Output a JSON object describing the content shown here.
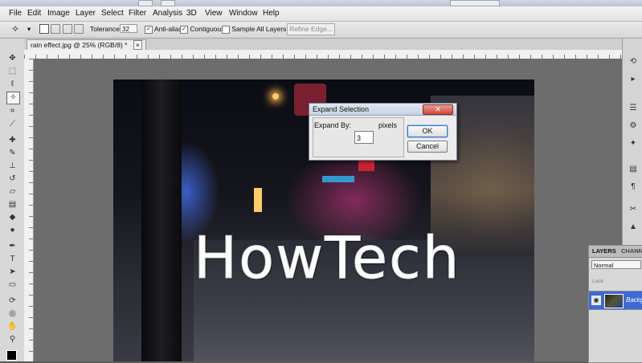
{
  "menu": [
    "File",
    "Edit",
    "Image",
    "Layer",
    "Select",
    "Filter",
    "Analysis",
    "3D",
    "View",
    "Window",
    "Help"
  ],
  "options_bar": {
    "tolerance_label": "Tolerance:",
    "tolerance_value": "32",
    "antialias_label": "Anti-alias",
    "contiguous_label": "Contiguous",
    "sample_all_label": "Sample All Layers",
    "refine_edge_label": "Refine Edge..."
  },
  "document_tab": {
    "title": "rain effect.jpg @ 25% (RGB/8) *",
    "close": "×"
  },
  "photo": {
    "watermark": "HowTech"
  },
  "dialog": {
    "title": "Expand Selection",
    "expand_by_label": "Expand By:",
    "expand_by_value": "3",
    "units_label": "pixels",
    "ok_label": "OK",
    "cancel_label": "Cancel",
    "close_symbol": "✕"
  },
  "layers_panel": {
    "tab_layers": "LAYERS",
    "tab_channels": "CHANNELS",
    "blend_mode": "Normal",
    "lock_label": "Lock:",
    "layer_name": "Backg"
  },
  "colors": {
    "dialog_title_bg": "#c7d3e2",
    "selected_layer": "#3d6ad6",
    "close_button": "#c9493a"
  }
}
